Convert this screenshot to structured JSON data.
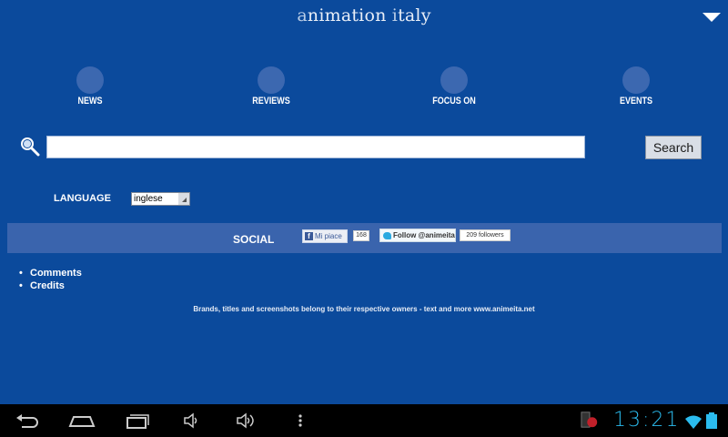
{
  "app": {
    "logo_first": "a",
    "logo_mid": "nimation ",
    "logo_second": "i",
    "logo_end": "taly"
  },
  "nav": [
    {
      "label": "NEWS"
    },
    {
      "label": "REVIEWS"
    },
    {
      "label": "FOCUS ON"
    },
    {
      "label": "EVENTS"
    }
  ],
  "search": {
    "value": "",
    "placeholder": "",
    "button_label": "Search"
  },
  "language": {
    "label": "LANGUAGE",
    "selected": "inglese"
  },
  "social": {
    "title": "SOCIAL",
    "fb_label": "Mi piace",
    "fb_count": "168",
    "tw_label": "Follow @animeita",
    "tw_count": "209 followers"
  },
  "links": [
    {
      "label": "Comments"
    },
    {
      "label": "Credits"
    }
  ],
  "footer": {
    "text": "Brands, titles and screenshots belong to their respective owners - text and more www.animeita.net"
  },
  "system": {
    "clock": "13:21"
  },
  "colors": {
    "background": "#0b4a9c",
    "social_bar": "#3a64ad",
    "clock": "#2bbcef"
  }
}
